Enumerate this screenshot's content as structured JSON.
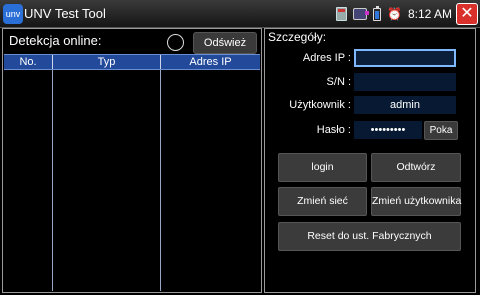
{
  "window": {
    "app_icon_text": "unv",
    "title": "UNV Test Tool",
    "clock": "8:12 AM",
    "close_symbol": "✕"
  },
  "online_panel": {
    "title": "Detekcja online:",
    "refresh_label": "Odśwież",
    "columns": [
      "No.",
      "Typ",
      "Adres IP"
    ],
    "rows": []
  },
  "details_panel": {
    "title": "Szczegóły:",
    "fields": {
      "ip": {
        "label": "Adres IP :",
        "value": ""
      },
      "sn": {
        "label": "S/N :",
        "value": ""
      },
      "user": {
        "label": "Użytkownik :",
        "value": "admin"
      },
      "password": {
        "label": "Hasło :",
        "value": "•••••••••"
      }
    },
    "show_password_label": "Poka",
    "buttons": {
      "login": "login",
      "play": "Odtwórz",
      "change_network": "Zmień sieć",
      "change_user": "Zmień użytkownika",
      "factory_reset": "Reset do ust. Fabrycznych"
    }
  },
  "colors": {
    "table_header": "#234a9a",
    "input_bg": "#081a33",
    "focus_border": "#7fb8ff",
    "close_button": "#d9302b"
  }
}
